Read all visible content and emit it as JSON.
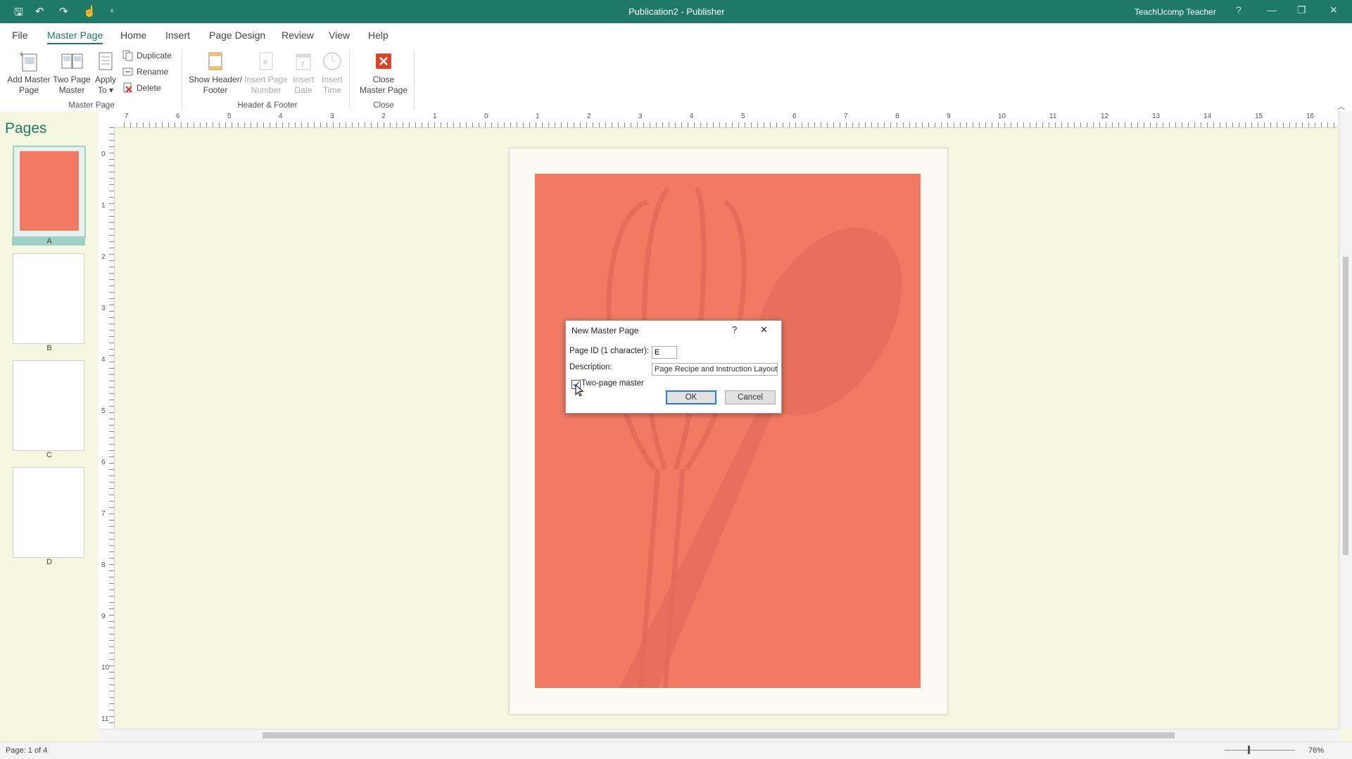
{
  "titlebar": {
    "title": "Publication2  -  Publisher",
    "user": "TeachUcomp Teacher",
    "help": "?",
    "minimize": "—",
    "restore": "❐",
    "close": "✕"
  },
  "qat": {
    "save": "🖫",
    "undo": "↶",
    "redo": "↷",
    "touch": "☝",
    "customize": "⩡"
  },
  "menu": [
    "File",
    "Master Page",
    "Home",
    "Insert",
    "Page Design",
    "Review",
    "View",
    "Help"
  ],
  "ribbon": {
    "add_master": "Add Master\nPage",
    "two_page": "Two Page\nMaster",
    "apply_to": "Apply\nTo ▾",
    "duplicate": "Duplicate",
    "rename": "Rename",
    "delete": "Delete",
    "group_master": "Master Page",
    "show_hf": "Show Header/\nFooter",
    "insert_page_number": "Insert Page\nNumber",
    "insert_date": "Insert\nDate",
    "insert_time": "Insert\nTime",
    "group_hf": "Header & Footer",
    "close_master": "Close\nMaster Page",
    "group_close": "Close"
  },
  "pages_pane": {
    "title": "Pages",
    "labels": [
      "A",
      "B",
      "C",
      "D"
    ]
  },
  "rulers": {
    "h": [
      "7",
      "6",
      "5",
      "4",
      "3",
      "2",
      "1",
      "0",
      "1",
      "2",
      "3",
      "4",
      "5",
      "6",
      "7",
      "8",
      "9",
      "10",
      "11",
      "12",
      "13",
      "14",
      "15",
      "16"
    ],
    "v": [
      "0",
      "1",
      "2",
      "3",
      "4",
      "5",
      "6",
      "7",
      "8",
      "9",
      "10",
      "11"
    ]
  },
  "dialog": {
    "title": "New Master Page",
    "help": "?",
    "close": "✕",
    "page_id_label": "Page ID (1 character):",
    "page_id_value": "E",
    "description_label": "Description:",
    "description_value": "Page Recipe and Instruction Layout",
    "two_page_label": "Two-page master",
    "two_page_checked": true,
    "ok": "OK",
    "cancel": "Cancel"
  },
  "status": {
    "page": "Page: 1 of 4",
    "zoom": "76%"
  },
  "colors": {
    "accent": "#1e7a66",
    "art": "#f27a63",
    "canvas": "#f5f7e1"
  }
}
